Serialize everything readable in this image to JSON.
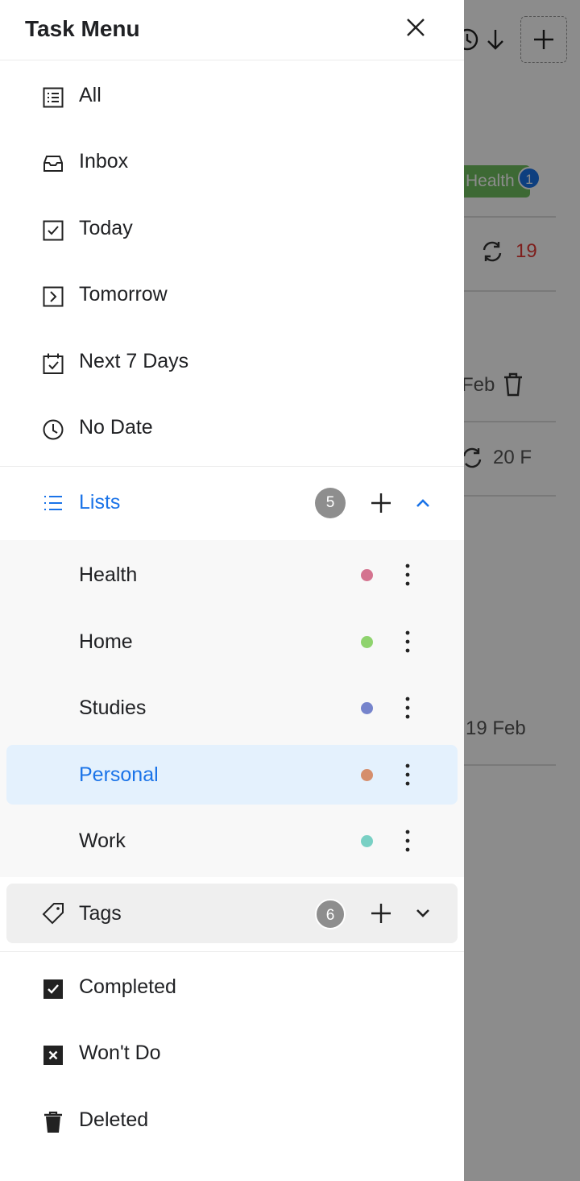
{
  "drawer": {
    "title": "Task Menu",
    "nav_items": [
      {
        "label": "All",
        "icon": "list-box-icon"
      },
      {
        "label": "Inbox",
        "icon": "inbox-icon"
      },
      {
        "label": "Today",
        "icon": "checkbox-today-icon"
      },
      {
        "label": "Tomorrow",
        "icon": "chevron-box-icon"
      },
      {
        "label": "Next 7 Days",
        "icon": "calendar-check-icon"
      },
      {
        "label": "No Date",
        "icon": "clock-icon"
      }
    ],
    "lists": {
      "label": "Lists",
      "count": "5",
      "expanded": true,
      "accent": "#1a73e8",
      "items": [
        {
          "label": "Health",
          "color": "#d4738f",
          "active": false
        },
        {
          "label": "Home",
          "color": "#8fd36e",
          "active": false
        },
        {
          "label": "Studies",
          "color": "#7684cc",
          "active": false
        },
        {
          "label": "Personal",
          "color": "#d58e6c",
          "active": true
        },
        {
          "label": "Work",
          "color": "#79d0c4",
          "active": false
        }
      ]
    },
    "tags": {
      "label": "Tags",
      "count": "6",
      "expanded": false
    },
    "bottom_items": [
      {
        "label": "Completed",
        "icon": "checkbox-filled-icon"
      },
      {
        "label": "Won't Do",
        "icon": "x-box-filled-icon"
      },
      {
        "label": "Deleted",
        "icon": "trash-icon"
      }
    ]
  },
  "background": {
    "chip_label": "Health",
    "chip_badge": "1",
    "row1_date": "19",
    "row2_date": "Feb",
    "row3_date": "20 F",
    "row4_date": "19 Feb"
  }
}
